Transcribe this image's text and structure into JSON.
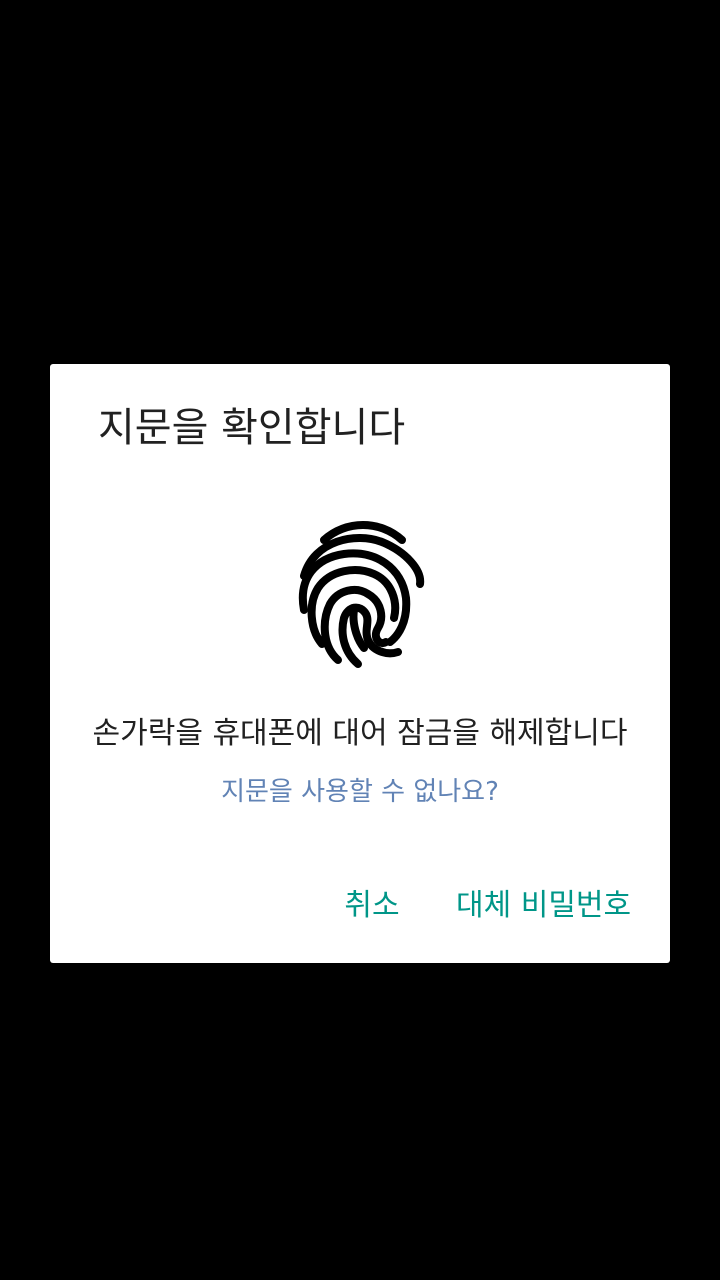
{
  "dialog": {
    "title": "지문을 확인합니다",
    "icon": "fingerprint-icon",
    "description": "손가락을 휴대폰에 대어 잠금을 해제합니다",
    "help_link": "지문을 사용할 수 없나요?",
    "buttons": {
      "cancel": "취소",
      "alternate": "대체 비밀번호"
    }
  },
  "colors": {
    "overlay": "#000000",
    "dialog_background": "#ffffff",
    "text_primary": "#212121",
    "link": "#6183b5",
    "button_accent": "#009688"
  }
}
